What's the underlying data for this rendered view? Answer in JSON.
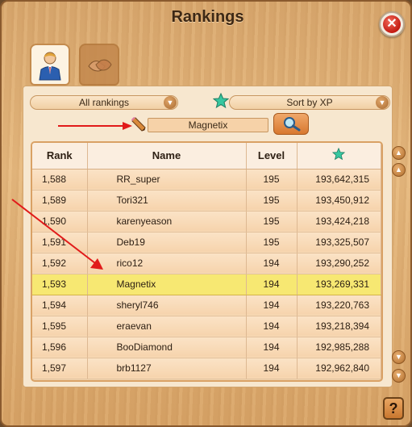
{
  "window": {
    "title": "Rankings"
  },
  "tabs": [
    {
      "name": "players",
      "icon": "person-icon",
      "active": true
    },
    {
      "name": "alliances",
      "icon": "handshake-icon",
      "active": false
    }
  ],
  "filters": {
    "scope": {
      "value": "All rankings"
    },
    "sort": {
      "value": "Sort by XP",
      "icon": "star-icon"
    }
  },
  "search": {
    "value": "Magnetix"
  },
  "table": {
    "headers": {
      "rank": "Rank",
      "name": "Name",
      "level": "Level",
      "xp_icon": "star-icon"
    },
    "rows": [
      {
        "rank": "1,588",
        "name": "RR_super",
        "level": "195",
        "xp": "193,642,315"
      },
      {
        "rank": "1,589",
        "name": "Tori321",
        "level": "195",
        "xp": "193,450,912"
      },
      {
        "rank": "1,590",
        "name": "karenyeason",
        "level": "195",
        "xp": "193,424,218"
      },
      {
        "rank": "1,591",
        "name": "Deb19",
        "level": "195",
        "xp": "193,325,507"
      },
      {
        "rank": "1,592",
        "name": "rico12",
        "level": "194",
        "xp": "193,290,252"
      },
      {
        "rank": "1,593",
        "name": "Magnetix",
        "level": "194",
        "xp": "193,269,331",
        "highlighted": true
      },
      {
        "rank": "1,594",
        "name": "sheryl746",
        "level": "194",
        "xp": "193,220,763"
      },
      {
        "rank": "1,595",
        "name": "eraevan",
        "level": "194",
        "xp": "193,218,394"
      },
      {
        "rank": "1,596",
        "name": "BooDiamond",
        "level": "194",
        "xp": "192,985,288"
      },
      {
        "rank": "1,597",
        "name": "brb1127",
        "level": "194",
        "xp": "192,962,840"
      }
    ]
  },
  "help": {
    "label": "?"
  },
  "close": {
    "label": "✕"
  },
  "colors": {
    "highlight": "#f7e872",
    "accent_star": "#37c7a0",
    "close_red": "#c31b12"
  }
}
